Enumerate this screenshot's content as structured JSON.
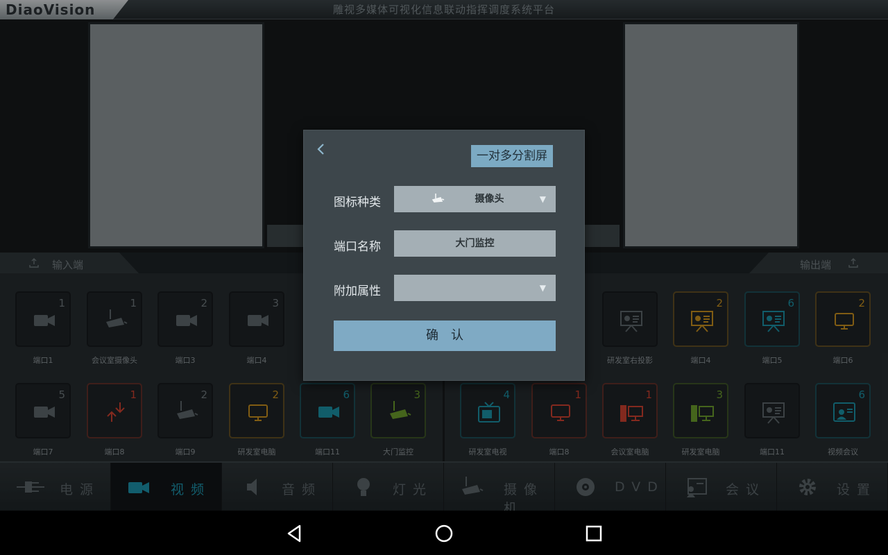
{
  "app": {
    "logo_text": "DiaoVision",
    "title": "雕视多媒体可视化信息联动指挥调度系统平台"
  },
  "input_panel": {
    "label": "输入端",
    "row1": [
      {
        "label": "端口1",
        "badge": "1",
        "icon": "video-camera-icon",
        "color": "#5d666a"
      },
      {
        "label": "会议室摄像头",
        "badge": "1",
        "icon": "cctv-camera-icon",
        "color": "#5d666a"
      },
      {
        "label": "端口3",
        "badge": "2",
        "icon": "video-camera-icon",
        "color": "#5d666a"
      },
      {
        "label": "端口4",
        "badge": "3",
        "icon": "video-camera-icon",
        "color": "#5d666a"
      }
    ],
    "row2": [
      {
        "label": "端口7",
        "badge": "5",
        "icon": "video-camera-icon",
        "color": "#5d666a"
      },
      {
        "label": "端口8",
        "badge": "1",
        "icon": "swap-arrows-icon",
        "color": "#c9402f"
      },
      {
        "label": "端口9",
        "badge": "2",
        "icon": "cctv-camera-icon",
        "color": "#5d666a"
      },
      {
        "label": "研发室电脑",
        "badge": "2",
        "icon": "monitor-icon",
        "color": "#c58e1e"
      },
      {
        "label": "端口11",
        "badge": "6",
        "icon": "video-camera-icon",
        "color": "#1b8fa3"
      },
      {
        "label": "大门监控",
        "badge": "3",
        "icon": "cctv-camera-icon",
        "color": "#6b9c2b"
      }
    ]
  },
  "output_panel": {
    "label": "输出端",
    "row1": [
      {
        "label": "研发室右投影",
        "badge": "",
        "icon": "projector-screen-icon",
        "color": "#5d666a"
      },
      {
        "label": "端口4",
        "badge": "2",
        "icon": "projector-screen-icon",
        "color": "#c58e1e"
      },
      {
        "label": "端口5",
        "badge": "6",
        "icon": "projector-screen-icon",
        "color": "#1b8fa3"
      },
      {
        "label": "端口6",
        "badge": "2",
        "icon": "monitor-icon",
        "color": "#c58e1e"
      }
    ],
    "row2": [
      {
        "label": "研发室电视",
        "badge": "4",
        "icon": "tv-icon",
        "color": "#1b8fa3"
      },
      {
        "label": "端口8",
        "badge": "1",
        "icon": "monitor-icon",
        "color": "#c9402f"
      },
      {
        "label": "会议室电脑",
        "badge": "1",
        "icon": "desktop-pc-icon",
        "color": "#c9402f"
      },
      {
        "label": "研发室电脑",
        "badge": "3",
        "icon": "desktop-pc-icon",
        "color": "#6b9c2b"
      },
      {
        "label": "端口11",
        "badge": "",
        "icon": "projector-screen-icon",
        "color": "#5d666a"
      },
      {
        "label": "视频会议",
        "badge": "6",
        "icon": "video-conference-icon",
        "color": "#1b8fa3"
      }
    ]
  },
  "nav": [
    {
      "label": "电源",
      "icon": "power-plug-icon"
    },
    {
      "label": "视频",
      "icon": "video-camera-icon",
      "active": true
    },
    {
      "label": "音频",
      "icon": "speaker-icon"
    },
    {
      "label": "灯光",
      "icon": "light-bulb-icon"
    },
    {
      "label": "摄像机",
      "icon": "cctv-camera-icon"
    },
    {
      "label": "DVD",
      "icon": "disc-icon"
    },
    {
      "label": "会议",
      "icon": "meeting-icon"
    },
    {
      "label": "设置",
      "icon": "gear-icon"
    }
  ],
  "dialog": {
    "mode": "一对多分割屏",
    "icon_type_label": "图标种类",
    "icon_type_value": "摄像头",
    "port_name_label": "端口名称",
    "port_name_value": "大门监控",
    "extra_attr_label": "附加属性",
    "extra_attr_value": "",
    "confirm_label": "确认",
    "accent": "#7caac3"
  }
}
